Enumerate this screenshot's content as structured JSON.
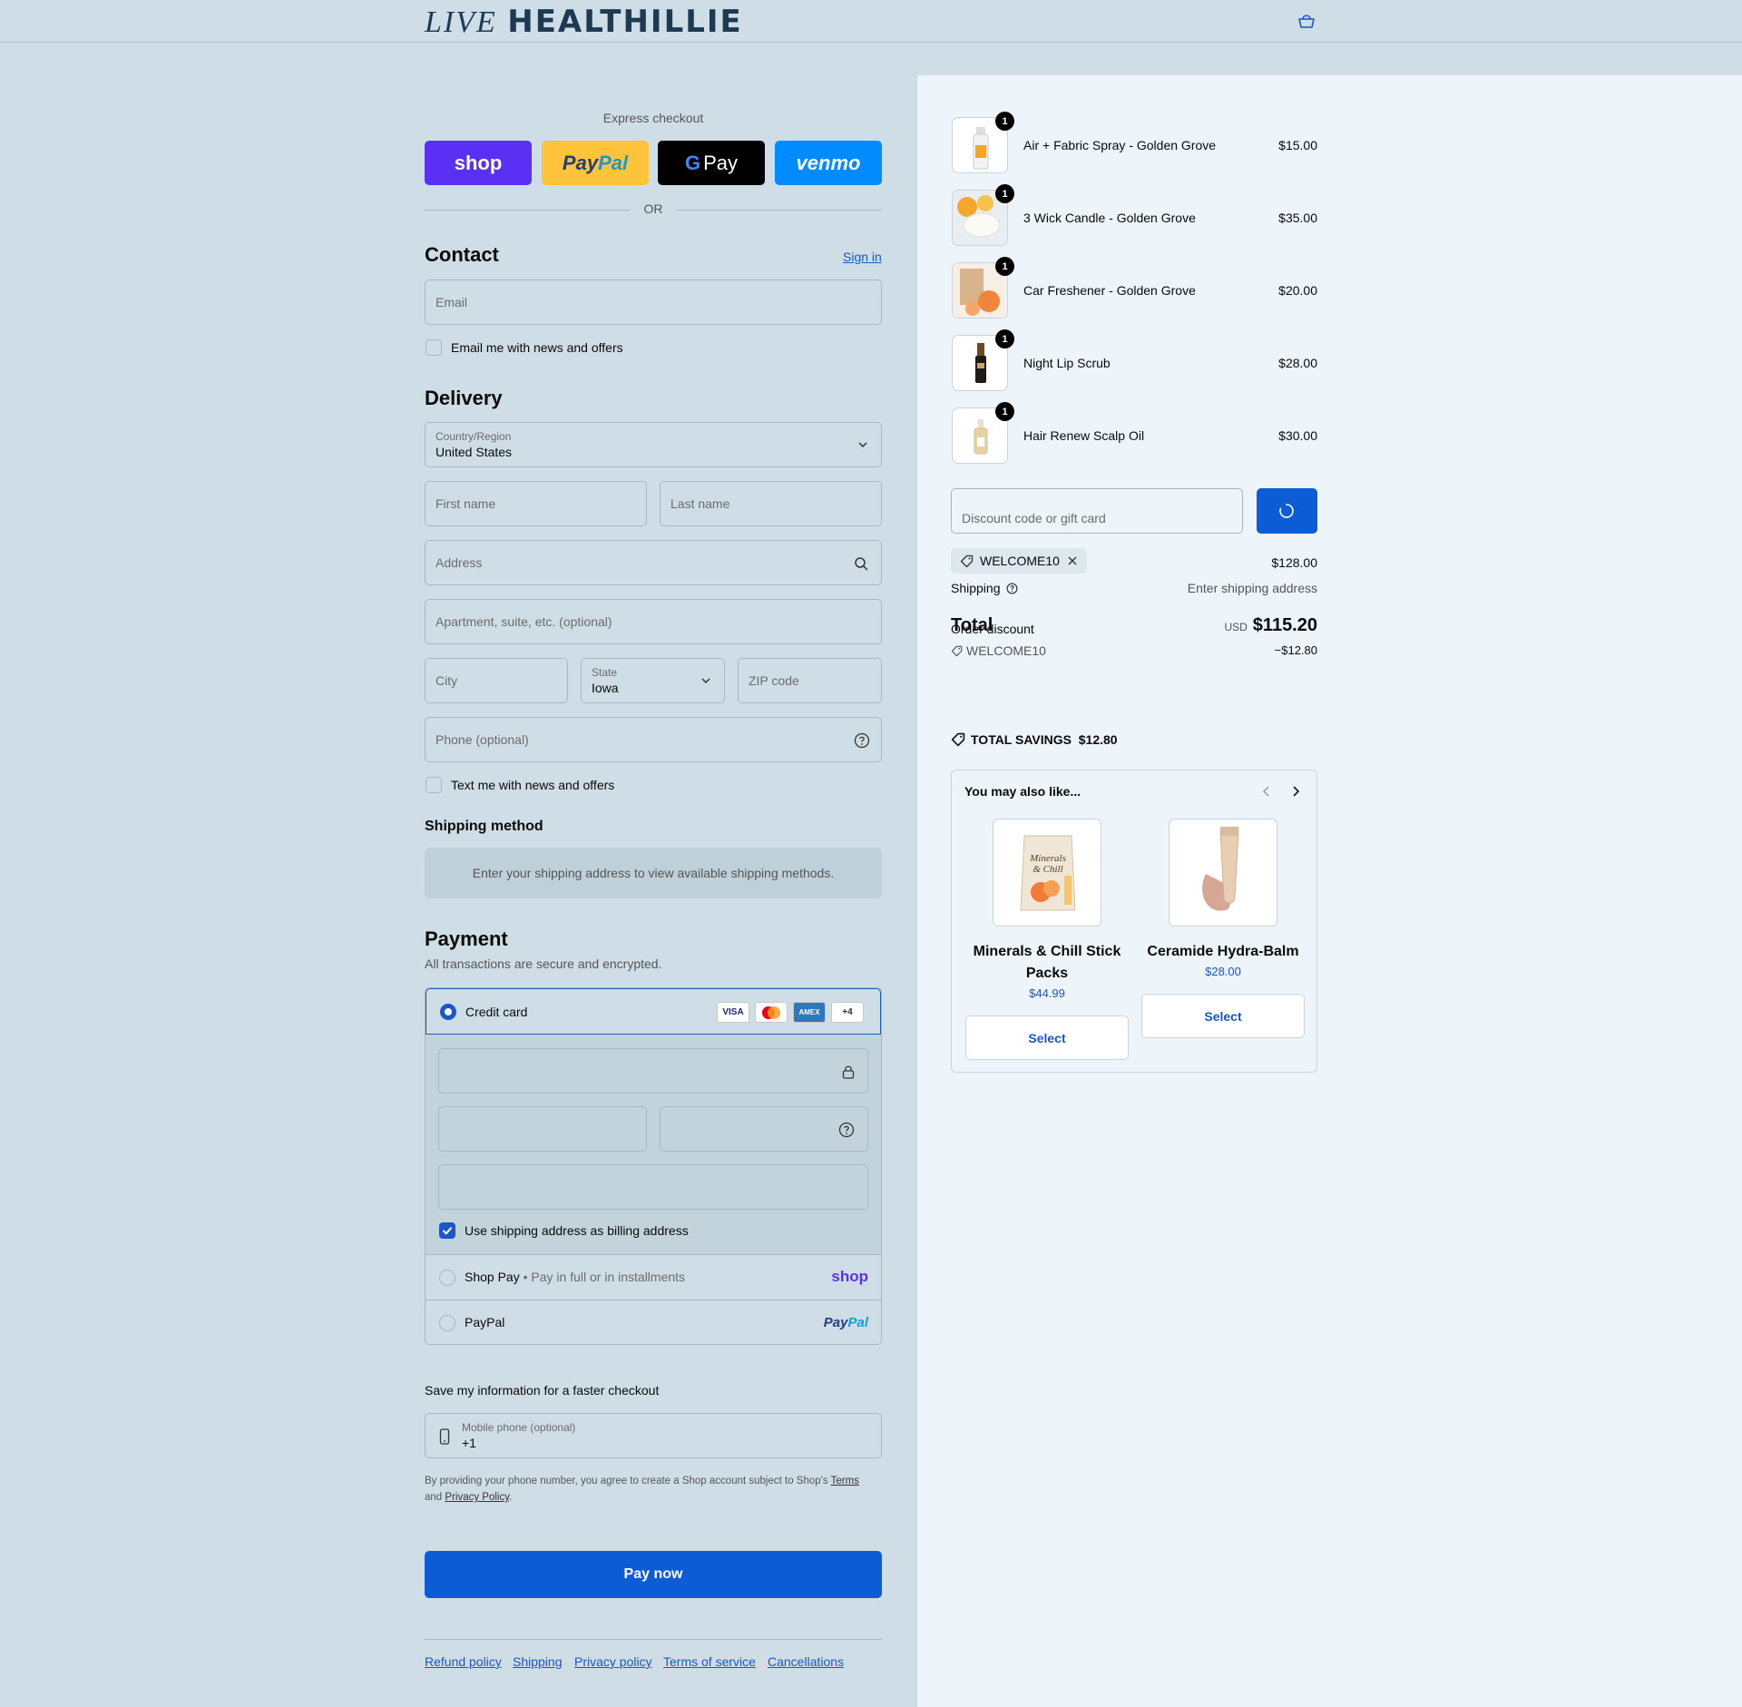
{
  "header": {
    "logo_live": "LIVE",
    "logo_brand": "HEALTHILLIE",
    "cart_icon": "bag-icon"
  },
  "express": {
    "label": "Express checkout",
    "buttons": {
      "shop": "shop",
      "paypal_pay": "Pay",
      "paypal_pal": "Pal",
      "gpay_g": "G",
      "gpay": "Pay",
      "venmo": "venmo"
    },
    "or": "OR"
  },
  "contact": {
    "title": "Contact",
    "sign_in": "Sign in",
    "email_placeholder": "Email",
    "newsletter_label": "Email me with news and offers"
  },
  "delivery": {
    "title": "Delivery",
    "country_label": "Country/Region",
    "country_value": "United States",
    "first_name": "First name",
    "last_name": "Last name",
    "address": "Address",
    "apartment": "Apartment, suite, etc. (optional)",
    "city": "City",
    "state_label": "State",
    "state_value": "Iowa",
    "zip": "ZIP code",
    "phone": "Phone (optional)",
    "sms_label": "Text me with news and offers"
  },
  "shipping_method": {
    "title": "Shipping method",
    "message": "Enter your shipping address to view available shipping methods."
  },
  "payment": {
    "title": "Payment",
    "subtitle": "All transactions are secure and encrypted.",
    "credit_card": "Credit card",
    "card_badges": [
      "VISA",
      "",
      "AMEX",
      "+4"
    ],
    "billing_label": "Use shipping address as billing address",
    "shop_pay": "Shop Pay",
    "shop_pay_sub": "Pay in full or in installments",
    "shop_pay_logo": "shop",
    "paypal": "PayPal",
    "paypal_logo_pay": "Pay",
    "paypal_logo_pal": "Pal"
  },
  "save_info": {
    "title": "Save my information for a faster checkout",
    "mobile_label": "Mobile phone (optional)",
    "mobile_value": "+1",
    "legal_1": "By providing your phone number, you agree to create a Shop account subject to Shop's ",
    "terms": "Terms",
    "legal_and": "and ",
    "privacy": "Privacy Policy",
    "legal_end": "."
  },
  "pay_now": "Pay now",
  "footer_links": [
    "Refund policy",
    "Shipping",
    "Privacy policy",
    "Terms of service",
    "Cancellations"
  ],
  "cart": {
    "items": [
      {
        "name": "Air + Fabric Spray - Golden Grove",
        "price": "$15.00",
        "qty": "1"
      },
      {
        "name": "3 Wick Candle - Golden Grove",
        "price": "$35.00",
        "qty": "1"
      },
      {
        "name": "Car Freshener - Golden Grove",
        "price": "$20.00",
        "qty": "1"
      },
      {
        "name": "Night Lip Scrub",
        "price": "$28.00",
        "qty": "1"
      },
      {
        "name": "Hair Renew Scalp Oil",
        "price": "$30.00",
        "qty": "1"
      }
    ],
    "discount_placeholder": "Discount code or gift card",
    "applied_code": "WELCOME10",
    "subtotal": "$128.00",
    "shipping_label": "Shipping",
    "shipping_value": "Enter shipping address",
    "order_discount_label": "Order discount",
    "total_label": "Total",
    "currency": "USD",
    "total": "$115.20",
    "discount_code": "WELCOME10",
    "discount_amount": "−$12.80",
    "savings_label": "TOTAL SAVINGS",
    "savings_value": "$12.80"
  },
  "recommendations": {
    "title": "You may also like...",
    "items": [
      {
        "name_1": "Minerals & Chill Stick",
        "name_2": "Packs",
        "price": "$44.99",
        "button": "Select",
        "img_text_1": "Minerals",
        "img_text_2": "& Chill"
      },
      {
        "name_1": "Ceramide Hydra-Balm",
        "price": "$28.00",
        "button": "Select"
      }
    ]
  },
  "colors": {
    "primary": "#0b5cd5",
    "shop": "#5a31f4",
    "paypal": "#ffc439",
    "venmo": "#008cff",
    "left_bg": "#cfdee6",
    "right_bg": "#eef5fa"
  }
}
